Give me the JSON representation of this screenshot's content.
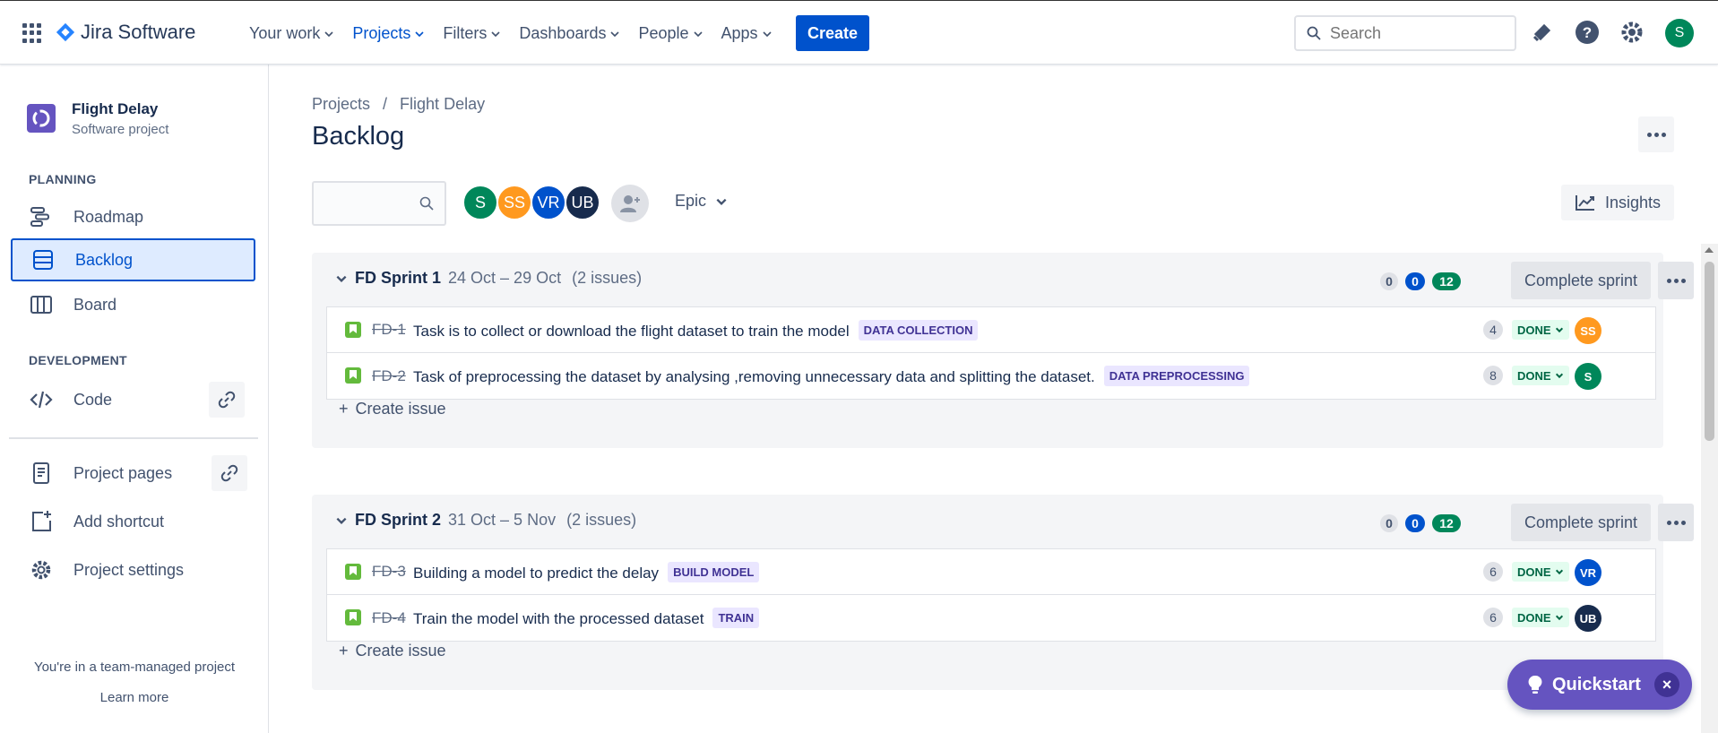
{
  "topbar": {
    "product_name": "Jira Software",
    "nav": [
      {
        "label": "Your work",
        "active": false
      },
      {
        "label": "Projects",
        "active": true
      },
      {
        "label": "Filters",
        "active": false
      },
      {
        "label": "Dashboards",
        "active": false
      },
      {
        "label": "People",
        "active": false
      },
      {
        "label": "Apps",
        "active": false
      }
    ],
    "create_label": "Create",
    "search_placeholder": "Search",
    "user_initial": "S",
    "icons": [
      "notifications-icon",
      "help-icon",
      "settings-icon"
    ]
  },
  "sidebar": {
    "project_name": "Flight Delay",
    "project_type": "Software project",
    "planning_header": "PLANNING",
    "planning_items": [
      {
        "label": "Roadmap",
        "icon": "roadmap-icon"
      },
      {
        "label": "Backlog",
        "icon": "backlog-icon",
        "active": true
      },
      {
        "label": "Board",
        "icon": "board-icon"
      }
    ],
    "development_header": "DEVELOPMENT",
    "code_label": "Code",
    "project_pages_label": "Project pages",
    "add_shortcut_label": "Add shortcut",
    "project_settings_label": "Project settings",
    "team_note": "You're in a team-managed project",
    "learn_more": "Learn more"
  },
  "main": {
    "breadcrumb": {
      "root": "Projects",
      "sep": "/",
      "current": "Flight Delay"
    },
    "title": "Backlog",
    "filter_avatars": [
      {
        "initials": "S",
        "color": "#00875a"
      },
      {
        "initials": "SS",
        "color": "#ff991f"
      },
      {
        "initials": "VR",
        "color": "#0052cc"
      },
      {
        "initials": "UB",
        "color": "#172b4d"
      }
    ],
    "epic_label": "Epic",
    "insights_label": "Insights"
  },
  "sprints": [
    {
      "name": "FD Sprint 1",
      "dates": "24 Oct – 29 Oct",
      "count": "(2 issues)",
      "todo": "0",
      "in_progress": "0",
      "done": "12",
      "complete_label": "Complete sprint",
      "create_issue_label": "Create issue",
      "issues": [
        {
          "key": "FD-1",
          "summary": "Task is to collect or download the flight dataset to train the model",
          "epic": "DATA COLLECTION",
          "points": "4",
          "status": "DONE",
          "assignee": "SS",
          "assignee_color": "#ff991f"
        },
        {
          "key": "FD-2",
          "summary": "Task of preprocessing the dataset by analysing ,removing unnecessary data and splitting the dataset.",
          "epic": "DATA PREPROCESSING",
          "points": "8",
          "status": "DONE",
          "assignee": "S",
          "assignee_color": "#00875a"
        }
      ]
    },
    {
      "name": "FD Sprint 2",
      "dates": "31 Oct – 5 Nov",
      "count": "(2 issues)",
      "todo": "0",
      "in_progress": "0",
      "done": "12",
      "complete_label": "Complete sprint",
      "create_issue_label": "Create issue",
      "issues": [
        {
          "key": "FD-3",
          "summary": "Building a model to predict the delay",
          "epic": "BUILD MODEL",
          "points": "6",
          "status": "DONE",
          "assignee": "VR",
          "assignee_color": "#0052cc"
        },
        {
          "key": "FD-4",
          "summary": "Train the model with the processed dataset",
          "epic": "TRAIN",
          "points": "6",
          "status": "DONE",
          "assignee": "UB",
          "assignee_color": "#172b4d"
        }
      ]
    }
  ],
  "quickstart": {
    "label": "Quickstart",
    "close": "×"
  }
}
